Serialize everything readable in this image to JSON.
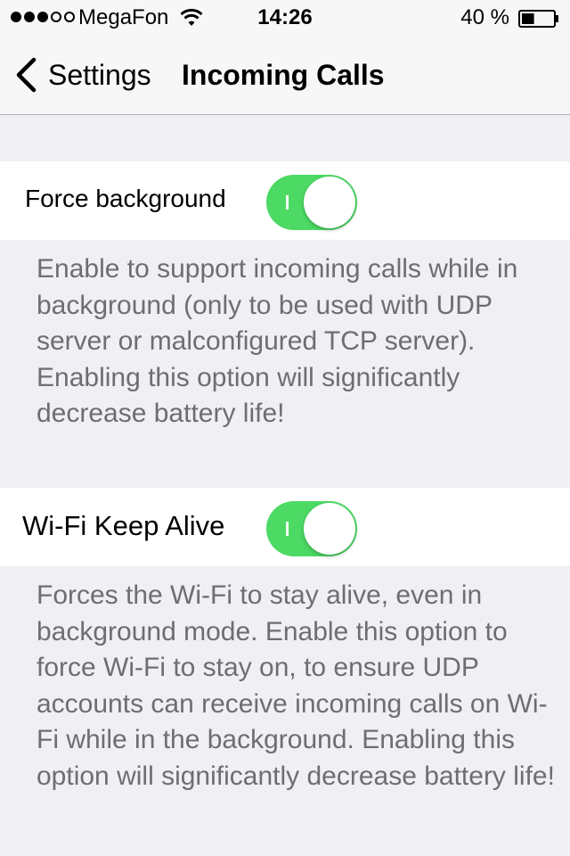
{
  "status_bar": {
    "signal_bars": 5,
    "signal_filled": 3,
    "carrier": "MegaFon",
    "time": "14:26",
    "battery_text": "40 %",
    "battery_level": 0.4
  },
  "nav": {
    "back_label": "Settings",
    "title": "Incoming Calls"
  },
  "settings": [
    {
      "label": "Force background",
      "enabled": true,
      "description": "Enable to support incoming calls while in background (only to be used with UDP server or malconfigured TCP server). Enabling this option will significantly decrease battery life!"
    },
    {
      "label": "Wi-Fi Keep Alive",
      "enabled": true,
      "description": "Forces the Wi-Fi to stay alive, even in background mode. Enable this option to force Wi-Fi to stay on, to ensure UDP accounts can receive incoming calls on Wi-Fi while in the background. Enabling this option will significantly decrease battery life!"
    }
  ],
  "colors": {
    "toggle_on": "#4cd964",
    "background": "#efeff4",
    "footer_text": "#6d6d72"
  }
}
